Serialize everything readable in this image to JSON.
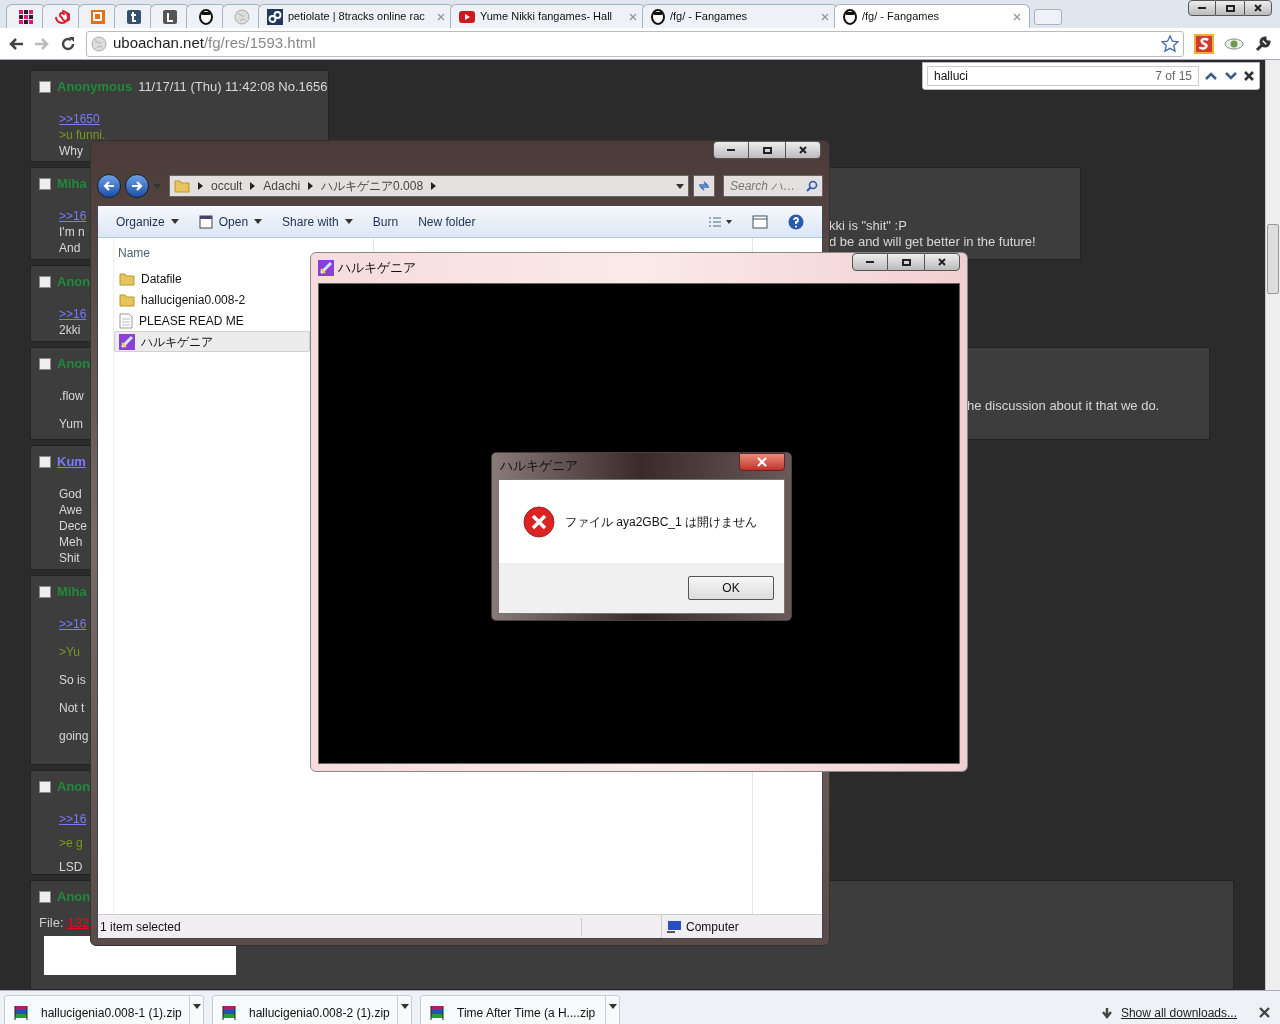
{
  "tabs": [
    {
      "kind": "icon",
      "selected": false
    },
    {
      "kind": "icon",
      "selected": false
    },
    {
      "kind": "icon",
      "selected": false
    },
    {
      "kind": "icon",
      "selected": false
    },
    {
      "kind": "icon",
      "selected": false
    },
    {
      "kind": "icon",
      "selected": false
    },
    {
      "kind": "icon",
      "selected": false
    },
    {
      "kind": "page",
      "label": "petiolate | 8tracks online rac",
      "selected": false
    },
    {
      "kind": "page",
      "label": "Yume Nikki fangames- Hall",
      "selected": false
    },
    {
      "kind": "page",
      "label": "/fg/ - Fangames",
      "selected": false
    },
    {
      "kind": "page",
      "label": "/fg/ - Fangames",
      "selected": true
    }
  ],
  "address": {
    "host": "uboachan.net",
    "path": "/fg/res/1593.html"
  },
  "find_bar": {
    "query": "halluci",
    "count": "7 of 15"
  },
  "posts": [
    {
      "name": "Anonymous",
      "linked": false,
      "checked": false,
      "meta": "11/17/11 (Thu) 11:42:08 No.1656",
      "lines": [
        {
          "kind": "link",
          "text": ">>1650"
        },
        {
          "kind": "quote",
          "text": ">u funni."
        },
        {
          "kind": "text",
          "text": "Why"
        }
      ]
    },
    {
      "name": "Miha",
      "linked": false,
      "checked": false,
      "lines": [
        {
          "kind": "link",
          "text": ">>16"
        },
        {
          "kind": "text",
          "text": "I'm n"
        },
        {
          "kind": "text",
          "text": "And"
        }
      ],
      "right_lines": [
        "kki is \"shit\" :P",
        "d be and will get better in the future!"
      ]
    },
    {
      "name": "Anon",
      "linked": false,
      "checked": false,
      "lines": [
        {
          "kind": "link",
          "text": ">>16"
        },
        {
          "kind": "text",
          "text": "2kki"
        }
      ]
    },
    {
      "name": "Anon",
      "linked": false,
      "checked": false,
      "lines": [
        {
          "kind": "text",
          "text": ".flow"
        },
        {
          "kind": "text",
          "text": "Yum"
        }
      ],
      "right_lines": [
        "he discussion about it that we do."
      ]
    },
    {
      "name": "Kum",
      "linked": true,
      "checked": false,
      "lines": [
        {
          "kind": "text",
          "text": "God"
        },
        {
          "kind": "text",
          "text": "Awe"
        },
        {
          "kind": "text",
          "text": "Dece"
        },
        {
          "kind": "text",
          "text": "Meh"
        },
        {
          "kind": "text",
          "text": "Shit"
        }
      ]
    },
    {
      "name": "Miha",
      "linked": false,
      "checked": false,
      "lines": [
        {
          "kind": "link",
          "text": ">>16"
        },
        {
          "kind": "quote",
          "text": ">Yu"
        },
        {
          "kind": "text",
          "text": "So is"
        },
        {
          "kind": "text",
          "text": "Not t"
        },
        {
          "kind": "text",
          "text": "going"
        }
      ]
    },
    {
      "name": "Anon",
      "linked": false,
      "checked": false,
      "lines": [
        {
          "kind": "link",
          "text": ">>16"
        },
        {
          "kind": "quote",
          "text": ">e g"
        },
        {
          "kind": "text",
          "text": "LSD"
        }
      ]
    },
    {
      "name": "Anon",
      "linked": false,
      "checked": false,
      "file_label": "File:",
      "file_link": "132"
    }
  ],
  "explorer": {
    "breadcrumb": [
      "occult",
      "Adachi",
      "ハルキゲニア0.008"
    ],
    "search_placeholder": "Search ハ…",
    "toolbar": [
      "Organize",
      "Open",
      "Share with",
      "Burn",
      "New folder"
    ],
    "columns": [
      "Name"
    ],
    "files": [
      {
        "name": "Datafile",
        "kind": "folder",
        "selected": false
      },
      {
        "name": "hallucigenia0.008-2",
        "kind": "folder",
        "selected": false
      },
      {
        "name": "PLEASE READ ME",
        "kind": "text",
        "selected": false
      },
      {
        "name": "ハルキゲニア",
        "kind": "app",
        "selected": true
      }
    ],
    "status": "1 item selected",
    "location": "Computer"
  },
  "game_window": {
    "title": "ハルキゲニア"
  },
  "dialog": {
    "title": "ハルキゲニア",
    "message": "ファイル aya2GBC_1 は開けません",
    "button": "OK"
  },
  "downloads": [
    {
      "name": "hallucigenia0.008-1 (1).zip"
    },
    {
      "name": "hallucigenia0.008-2 (1).zip"
    },
    {
      "name": "Time After Time (a H....zip"
    }
  ],
  "show_all": "Show all downloads..."
}
